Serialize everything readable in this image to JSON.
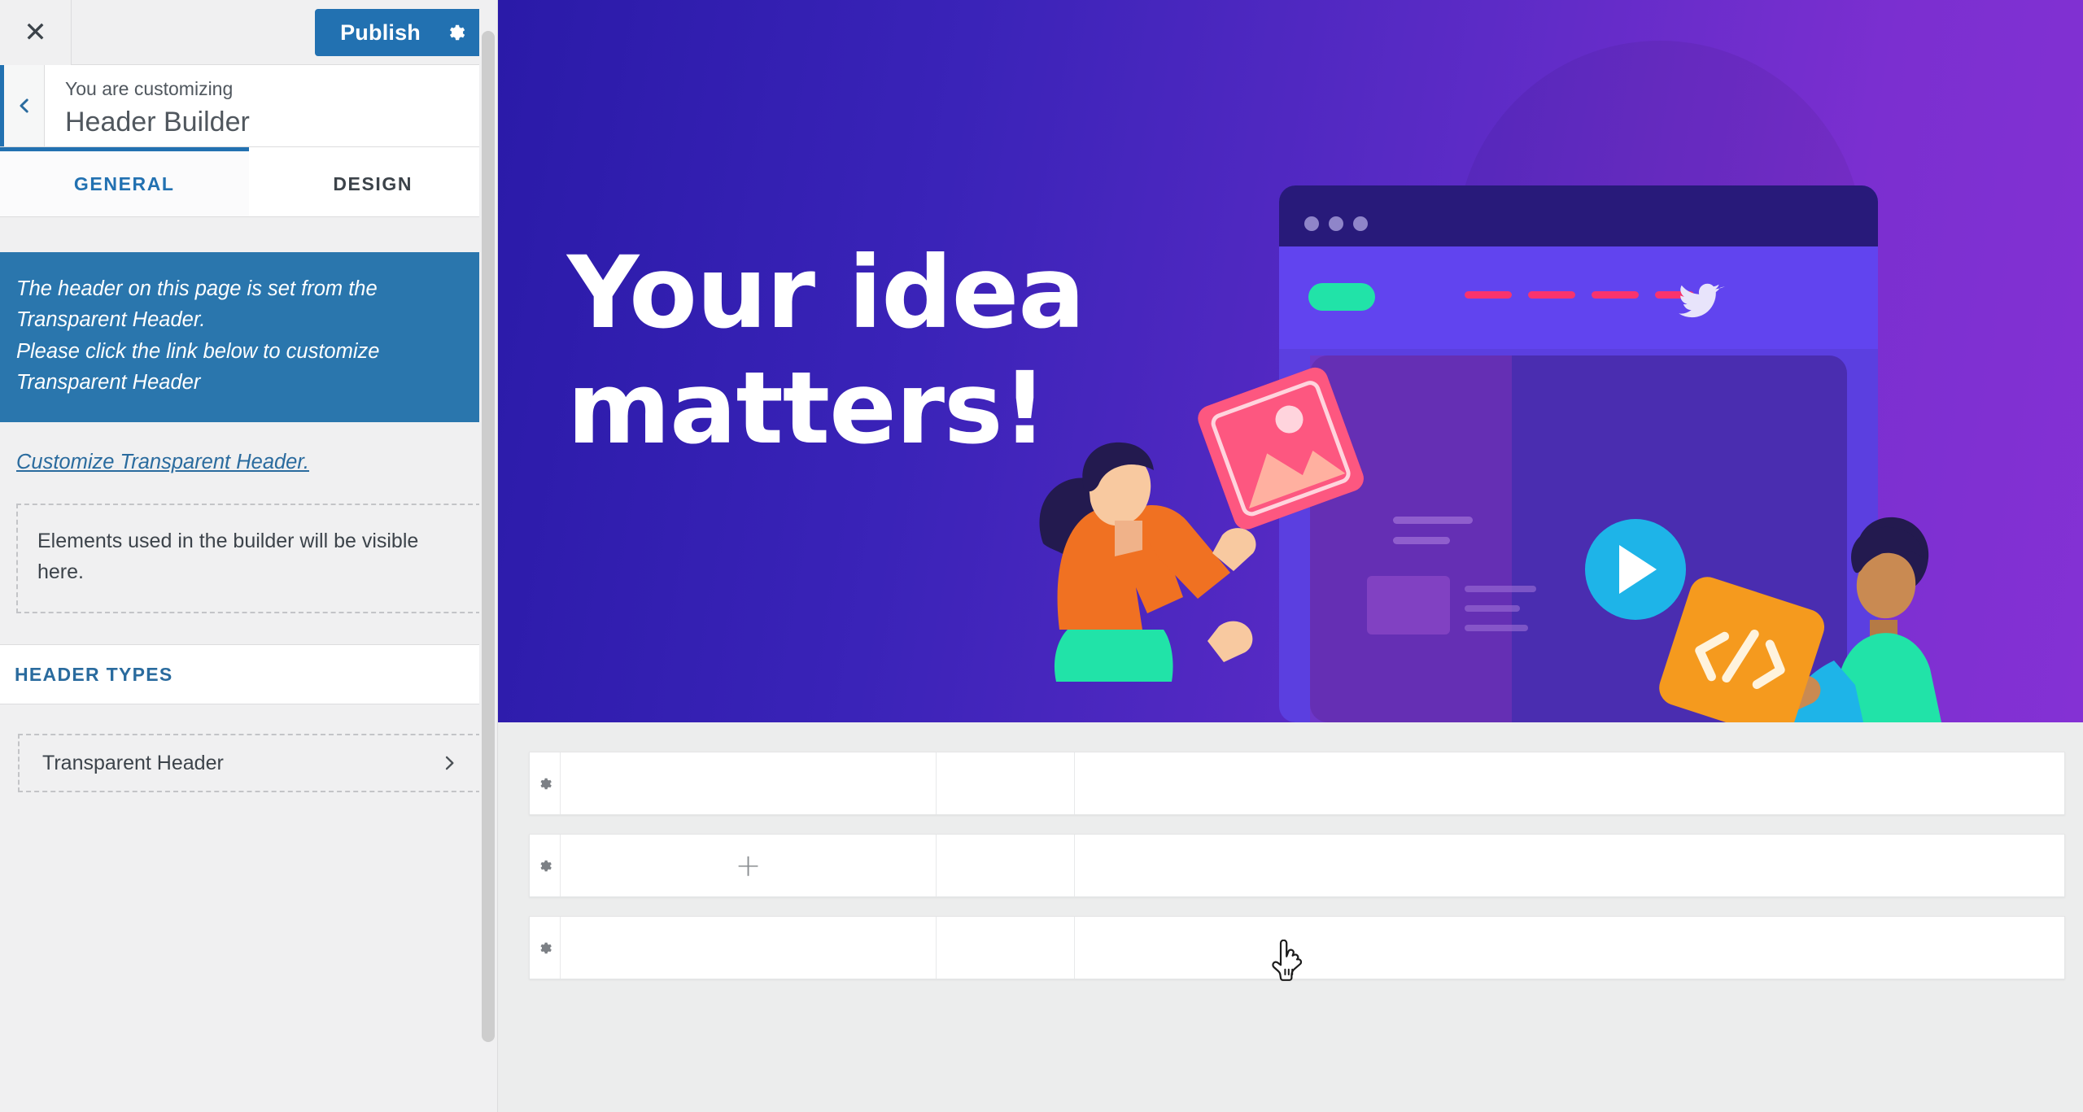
{
  "topbar": {
    "close_label": "✕",
    "close_icon": "close-icon",
    "publish_label": "Publish",
    "publish_gear_icon": "gear-icon"
  },
  "panel": {
    "back_icon": "chevron-left-icon",
    "eyebrow": "You are customizing",
    "title": "Header Builder"
  },
  "tabs": [
    {
      "label": "GENERAL",
      "active": true
    },
    {
      "label": "DESIGN",
      "active": false
    }
  ],
  "notice": {
    "line1": "The header on this page is set from the Transparent Header.",
    "line2": "Please click the link below to customize Transparent Header",
    "background": "#2a76ad"
  },
  "notice_link": {
    "label": "Customize Transparent Header.",
    "color": "#2a6b9e"
  },
  "elements_box": {
    "text": "Elements used in the builder will be visible here."
  },
  "header_types": {
    "section_label": "HEADER TYPES",
    "section_label_color": "#2a6b9e",
    "items": [
      {
        "label": "Transparent Header",
        "chevron_icon": "chevron-right-icon"
      }
    ]
  },
  "scrollbar": {
    "name": "sidebar-scrollbar"
  },
  "preview": {
    "hero": {
      "title": "Your idea\nmatters!",
      "gradient_from": "#2a1aa8",
      "gradient_to": "#8431d4",
      "illustration": "team-building-website-illustration"
    },
    "builder_rows": [
      {
        "gear_icon": "gear-icon",
        "center_content": ""
      },
      {
        "gear_icon": "gear-icon",
        "center_content": "+"
      },
      {
        "gear_icon": "gear-icon",
        "center_content": ""
      }
    ],
    "cursor": "pointer-hand-cursor"
  },
  "colors": {
    "accent_blue": "#2271b1",
    "notice_blue": "#2a76ad",
    "sidebar_bg": "#f0f0f1",
    "preview_bg": "#eceded"
  }
}
